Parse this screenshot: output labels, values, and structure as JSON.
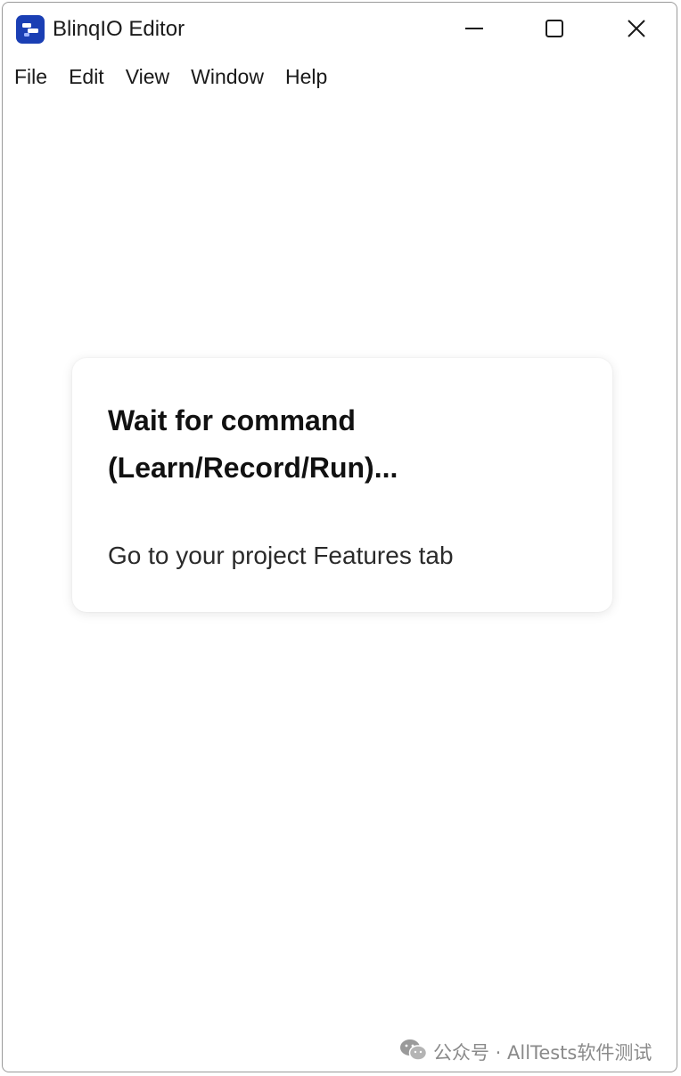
{
  "window": {
    "title": "BlinqIO Editor",
    "app_icon": "blinqio-logo-icon",
    "controls": [
      "minimize-icon",
      "maximize-icon",
      "close-icon"
    ]
  },
  "menu": {
    "items": [
      {
        "label": "File"
      },
      {
        "label": "Edit"
      },
      {
        "label": "View"
      },
      {
        "label": "Window"
      },
      {
        "label": "Help"
      }
    ]
  },
  "card": {
    "heading": "Wait for command (Learn/Record/Run)...",
    "subtext": "Go to your project Features tab"
  },
  "watermark": {
    "icon": "wechat-icon",
    "text": "公众号 · AllTests软件测试"
  },
  "colors": {
    "app_icon_bg": "#1a3fb4",
    "text": "#1a1a1a",
    "watermark_text": "#8a8a8a"
  }
}
